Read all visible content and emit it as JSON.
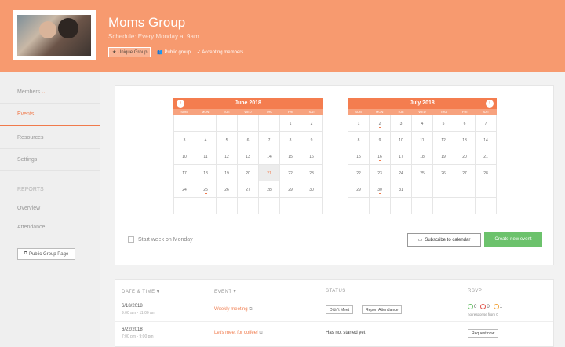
{
  "header": {
    "title": "Moms Group",
    "schedule": "Schedule: Every Monday at 9am",
    "tag_unique": "Unique Group",
    "tag_public": "Public group",
    "tag_accepting": "Accepting members"
  },
  "sidebar": {
    "members": "Members",
    "events": "Events",
    "resources": "Resources",
    "settings": "Settings",
    "reports_heading": "REPORTS",
    "overview": "Overview",
    "attendance": "Attendance",
    "public_page_button": "Public Group Page"
  },
  "calendar": {
    "dow": [
      "SUN",
      "MON",
      "TUE",
      "WED",
      "THU",
      "FRI",
      "SAT"
    ],
    "months": [
      {
        "title": "June 2018",
        "days": [
          "",
          "",
          "",
          "",
          "",
          "1",
          "2",
          "3",
          "4",
          "5",
          "6",
          "7",
          "8",
          "9",
          "10",
          "11",
          "12",
          "13",
          "14",
          "15",
          "16",
          "17",
          "18",
          "19",
          "20",
          "21",
          "22",
          "23",
          "24",
          "25",
          "26",
          "27",
          "28",
          "29",
          "30",
          "",
          "",
          "",
          "",
          "",
          "",
          ""
        ],
        "event_days": [
          "18",
          "22",
          "25"
        ],
        "today": "21"
      },
      {
        "title": "July 2018",
        "days": [
          "1",
          "2",
          "3",
          "4",
          "5",
          "6",
          "7",
          "8",
          "9",
          "10",
          "11",
          "12",
          "13",
          "14",
          "15",
          "16",
          "17",
          "18",
          "19",
          "20",
          "21",
          "22",
          "23",
          "24",
          "25",
          "26",
          "27",
          "28",
          "29",
          "30",
          "31",
          "",
          "",
          "",
          "",
          "",
          "",
          "",
          "",
          "",
          "",
          ""
        ],
        "event_days": [
          "2",
          "9",
          "16",
          "23",
          "27",
          "30"
        ],
        "today": ""
      }
    ],
    "start_week_label": "Start week on Monday",
    "subscribe_label": "Subscribe to calendar",
    "create_label": "Create new event"
  },
  "table": {
    "headers": [
      "DATE & TIME",
      "EVENT",
      "STATUS",
      "RSVP"
    ],
    "rows": [
      {
        "date": "6/18/2018",
        "time": "9:00 am - 11:00 am",
        "event": "Weekly meeting",
        "status_btn1": "Didn't Meet",
        "status_btn2": "Report Attendance",
        "rsvp_yes": "0",
        "rsvp_no": "0",
        "rsvp_maybe": "1",
        "rsvp_note": "no response from 0"
      },
      {
        "date": "6/22/2018",
        "time": "7:00 pm - 9:00 pm",
        "event": "Let's meet for coffee!",
        "status": "Has not started yet",
        "rsvp_button": "Request now"
      }
    ]
  },
  "colors": {
    "brand": "#f79a6f",
    "accent": "#f07a4b",
    "create_button": "#6cc26c"
  }
}
